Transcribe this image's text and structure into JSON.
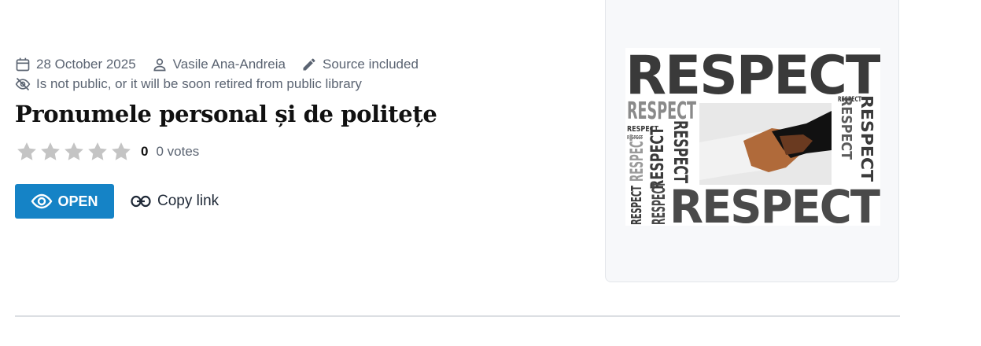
{
  "meta": {
    "date": "28 October 2025",
    "author": "Vasile Ana-Andreia",
    "source": "Source included",
    "visibility": "Is not public, or it will be soon retired from public library"
  },
  "title": "Pronumele personal și de politețe",
  "rating": {
    "average": "0",
    "votes_label": "0 votes",
    "stars_filled": 0,
    "stars_total": 5
  },
  "actions": {
    "open_label": "OPEN",
    "copy_label": "Copy link"
  },
  "thumbnail": {
    "word": "RESPECT",
    "colors": {
      "accent": "#1583c6",
      "dark": "#3a3a3a",
      "mid": "#7a7a7a",
      "light": "#a8a8a8"
    }
  }
}
